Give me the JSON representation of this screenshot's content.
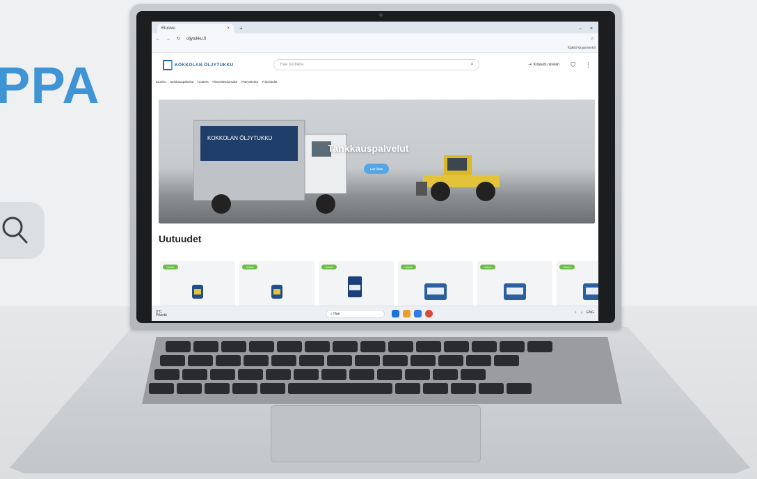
{
  "background": {
    "heading": "PPA",
    "search_icon": "search-icon"
  },
  "browser": {
    "tab_title": "Etusivu",
    "tab_close": "×",
    "new_tab": "+",
    "url": "oljytukku.fi",
    "bookmarks_folder": "Kaikki kirjanmerkit",
    "window_minimize": "–",
    "window_close": "×"
  },
  "site": {
    "logo_text": "KOKKOLAN ÖLJYTUKKU",
    "search_placeholder": "Hae tuotteita",
    "login_label": "Kirjaudu sisään",
    "nav": [
      "Etusivu",
      "Tankkauspalvelut",
      "Tuotteet",
      "Yhteystietolomake",
      "Yhteystiedot",
      "Yritystiedot"
    ],
    "hero_title": "Tankkauspalvelut",
    "hero_button": "Lue lisää",
    "truck_text": "KOKKOLAN ÖLJYTUKKU",
    "section_title": "Uutuudet",
    "products": [
      {
        "badge": "Uutuus"
      },
      {
        "badge": "Uutuus"
      },
      {
        "badge": "Uutuus"
      },
      {
        "badge": "Uutuus"
      },
      {
        "badge": "Uutuus"
      },
      {
        "badge": "Uutuus"
      }
    ]
  },
  "taskbar": {
    "weather_temp": "0°C",
    "weather_text": "Pilvistä",
    "search_label": "Hae",
    "tray_text": "ENG"
  },
  "colors": {
    "accent": "#56a6e6",
    "brand": "#2a64a8",
    "badge": "#6bbd45"
  }
}
